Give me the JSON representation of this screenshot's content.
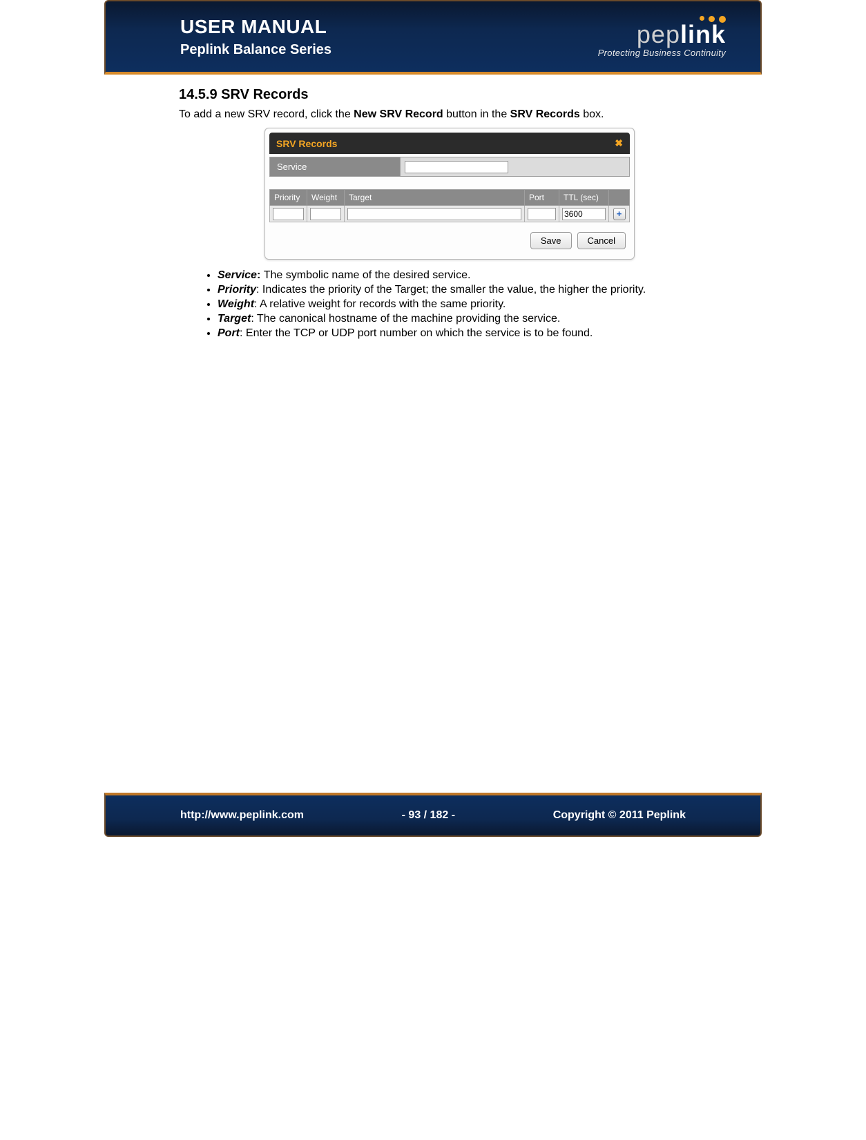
{
  "header": {
    "title": "USER MANUAL",
    "subtitle": "Peplink Balance Series",
    "brand": "peplink",
    "tagline": "Protecting Business Continuity"
  },
  "section": {
    "heading": "14.5.9 SRV Records",
    "intro_pre": "To add a new SRV record, click the ",
    "intro_bold1": "New SRV Record",
    "intro_mid": " button in the ",
    "intro_bold2": "SRV Records",
    "intro_post": " box."
  },
  "dialog": {
    "title": "SRV Records",
    "service_label": "Service",
    "service_value": "",
    "columns": {
      "priority": "Priority",
      "weight": "Weight",
      "target": "Target",
      "port": "Port",
      "ttl": "TTL (sec)"
    },
    "row": {
      "priority": "",
      "weight": "",
      "target": "",
      "port": "",
      "ttl": "3600"
    },
    "add_label": "+",
    "save": "Save",
    "cancel": "Cancel"
  },
  "fields": [
    {
      "term": "Service",
      "sep": ": ",
      "desc": "The symbolic name of the desired service."
    },
    {
      "term": "Priority",
      "sep": ": ",
      "desc": "Indicates the priority of the Target; the smaller the value, the higher the priority."
    },
    {
      "term": "Weight",
      "sep": ": ",
      "desc": "A relative weight for records with the same priority."
    },
    {
      "term": "Target",
      "sep": ": ",
      "desc": "The canonical hostname of the machine providing the service."
    },
    {
      "term": "Port",
      "sep": ": ",
      "desc": "Enter the TCP or UDP port number on which the service is to be found."
    }
  ],
  "footer": {
    "url": "http://www.peplink.com",
    "page": "- 93 / 182 -",
    "copyright": "Copyright © 2011 Peplink"
  }
}
